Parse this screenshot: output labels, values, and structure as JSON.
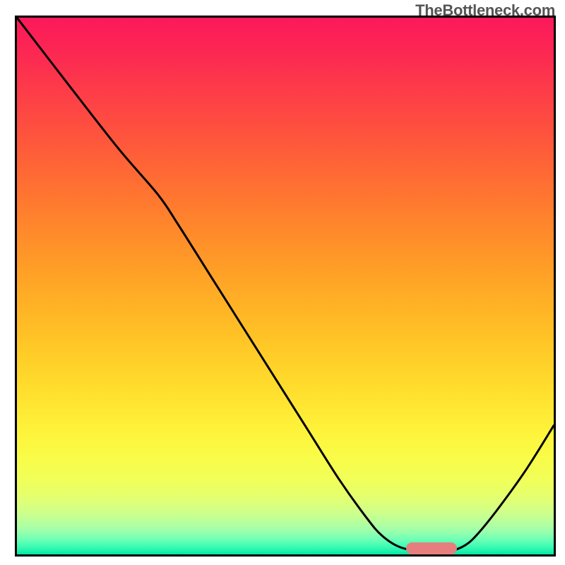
{
  "watermark_text": "TheBottleneck.com",
  "chart_data": {
    "type": "line",
    "title": "",
    "xlabel": "",
    "ylabel": "",
    "x_range": [
      0,
      100
    ],
    "y_range": [
      0,
      100
    ],
    "grid": false,
    "legend": false,
    "gradient_stops": [
      {
        "offset": 0,
        "color": "#fb195a"
      },
      {
        "offset": 0.06,
        "color": "#fc2653"
      },
      {
        "offset": 0.14,
        "color": "#fd3d48"
      },
      {
        "offset": 0.22,
        "color": "#fe543d"
      },
      {
        "offset": 0.3,
        "color": "#ff6c33"
      },
      {
        "offset": 0.38,
        "color": "#ff842c"
      },
      {
        "offset": 0.46,
        "color": "#ff9c27"
      },
      {
        "offset": 0.54,
        "color": "#ffb325"
      },
      {
        "offset": 0.62,
        "color": "#ffca27"
      },
      {
        "offset": 0.7,
        "color": "#ffe02e"
      },
      {
        "offset": 0.77,
        "color": "#fef33a"
      },
      {
        "offset": 0.82,
        "color": "#f9fc48"
      },
      {
        "offset": 0.86,
        "color": "#f1ff58"
      },
      {
        "offset": 0.885,
        "color": "#e8ff69"
      },
      {
        "offset": 0.905,
        "color": "#dcff7a"
      },
      {
        "offset": 0.922,
        "color": "#ceff8a"
      },
      {
        "offset": 0.935,
        "color": "#beff98"
      },
      {
        "offset": 0.948,
        "color": "#abffa4"
      },
      {
        "offset": 0.958,
        "color": "#98ffac"
      },
      {
        "offset": 0.965,
        "color": "#83ffb2"
      },
      {
        "offset": 0.972,
        "color": "#6effb5"
      },
      {
        "offset": 0.978,
        "color": "#58ffb5"
      },
      {
        "offset": 0.984,
        "color": "#42fcb3"
      },
      {
        "offset": 0.99,
        "color": "#2cf6af"
      },
      {
        "offset": 0.996,
        "color": "#15eda9"
      },
      {
        "offset": 1.0,
        "color": "#00e5a3"
      }
    ],
    "series": [
      {
        "name": "bottleneck-curve",
        "color": "#000000",
        "width": 3,
        "points": [
          {
            "x": 0,
            "y": 100
          },
          {
            "x": 10,
            "y": 87
          },
          {
            "x": 19,
            "y": 75.5
          },
          {
            "x": 26.3,
            "y": 67
          },
          {
            "x": 30,
            "y": 61.5
          },
          {
            "x": 36,
            "y": 52
          },
          {
            "x": 42,
            "y": 42.5
          },
          {
            "x": 48,
            "y": 33
          },
          {
            "x": 54,
            "y": 23.5
          },
          {
            "x": 60,
            "y": 14
          },
          {
            "x": 65,
            "y": 7
          },
          {
            "x": 68,
            "y": 3.5
          },
          {
            "x": 71.5,
            "y": 1.3
          },
          {
            "x": 76,
            "y": 0.6
          },
          {
            "x": 80.5,
            "y": 0.6
          },
          {
            "x": 83.5,
            "y": 1.7
          },
          {
            "x": 86,
            "y": 4
          },
          {
            "x": 90,
            "y": 9
          },
          {
            "x": 95,
            "y": 16
          },
          {
            "x": 100,
            "y": 24
          }
        ]
      }
    ],
    "marker": {
      "name": "optimal-range",
      "x_center": 77.2,
      "width_pct": 9.5,
      "y_pct": 1.1,
      "height_pct": 2.2,
      "color": "#e77e7e"
    }
  }
}
